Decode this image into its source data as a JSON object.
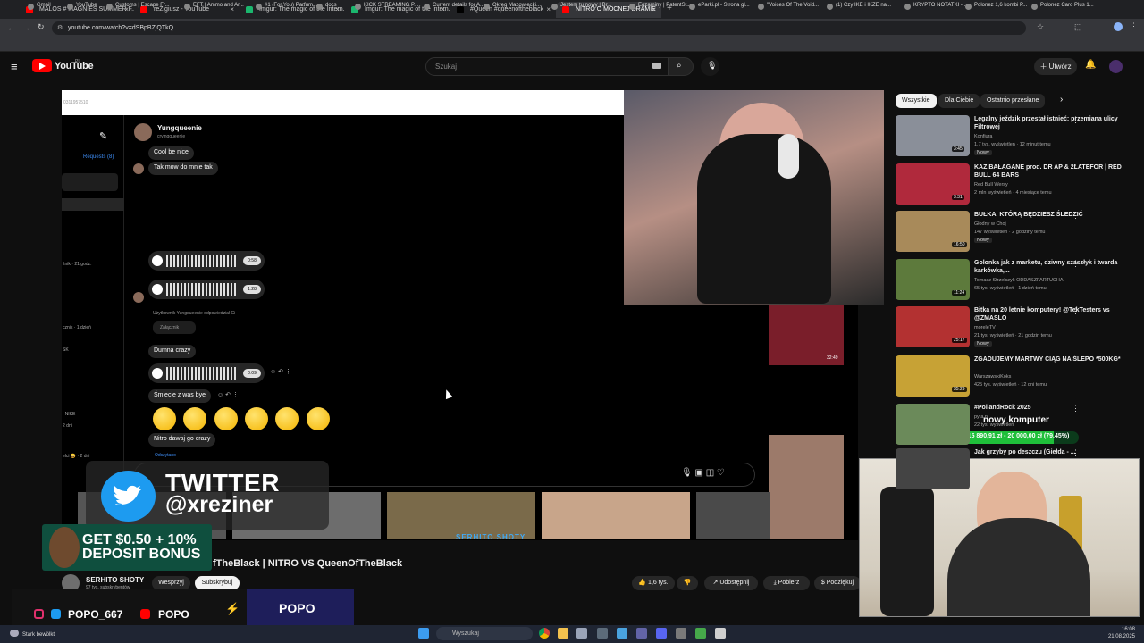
{
  "tabs": [
    {
      "label": "MALOS # MAGNIES SUMMER F...",
      "color": "#ff0000"
    },
    {
      "label": "reZigiusz - YouTube",
      "color": "#ff0000"
    },
    {
      "label": "Imgur: The magic of the Intern...",
      "color": "#1bb76e"
    },
    {
      "label": "Imgur: The magic of the Intern...",
      "color": "#1bb76e"
    },
    {
      "label": "#Queen #queenoftheblack",
      "color": "#000000"
    },
    {
      "label": "NITRO O MOCNEJ DRAMIE",
      "color": "#ff0000"
    }
  ],
  "address": {
    "url": "youtube.com/watch?v=dSBpBZjQTkQ"
  },
  "bookmarks": [
    "Gmail",
    "YouTube",
    "Customs | Escape Fr...",
    "EFT | Ammo and Ar...",
    "#1 (For You) Parfum...",
    "docs",
    "KICK STREAMING P...",
    "Current details for A...",
    "Okręg Mazowiecki...",
    "Jestem tu nowy | Br...",
    "Egzaminy | PatentSt...",
    "eParki.pl - Strona gl...",
    "\"Voices Of The Void...",
    "(1) Czy IKE i IKZE na...",
    "KRYPTO NOTATKI -...",
    "Polonez 1,6 kombi P...",
    "Polonez Caro Plus 1..."
  ],
  "header": {
    "logo": "YouTube",
    "logo_sup": "PL",
    "search_placeholder": "Szukaj",
    "create_label": "Utwórz"
  },
  "ig": {
    "chat_id": "0311957510",
    "username": "Yungqueenie",
    "handle": "cryingqueenie",
    "requests": "Requests (8)",
    "side_items": [
      "źnik · 21 godz.",
      "cznik · 1 dzień",
      "SK",
      "| NIKE",
      "2 dni",
      "elci 😀 · 2 dni"
    ],
    "messages": [
      "Cool be nice",
      "Tak mow do mnie tak",
      "Dumna crazy",
      "Śmiecie z was bye",
      "Nitro dawaj go crazy"
    ],
    "reply_note": "Użytkownik Yungqueenie odpowiedział Ci",
    "attachment": "Załącznik",
    "voice_durations": [
      "0:58",
      "1:28",
      "0:09"
    ],
    "seen": "Odczytano"
  },
  "overlays": {
    "twitter_title": "TWITTER",
    "twitter_handle": "@xreziner_",
    "bonus_line1": "GET $0.50 + 10%",
    "bonus_line2": "DEPOSIT BONUS",
    "shorts_tag": "SERHITO SHOTY",
    "popo_handle": "POPO_667",
    "popo_name": "POPO",
    "popo_title": "POPO",
    "goal_title": "nowy komputer",
    "goal_text": "15 890,91 zł - 20 000,00 zł (79.45%)",
    "goal_fraction": 0.7945
  },
  "video": {
    "title": "fTheBlack | NITRO VS QueenOfTheBlack",
    "channel": "SERHITO SHOTY",
    "subs": "97 tys. subskrybentów",
    "join_label": "Wesprzyj",
    "subscribe_label": "Subskrybuj",
    "likes": "1,6 tys.",
    "share_label": "Udostępnij",
    "download_label": "Pobierz",
    "thanks_label": "Podziękuj",
    "player_duration": "32:49"
  },
  "chips": [
    "Wszystkie",
    "Dla Ciebie",
    "Ostatnio przesłane"
  ],
  "recommendations": [
    {
      "title": "Legalny jeździk przestał istnieć: przemiana ulicy Filtrowej",
      "channel": "Konfiura",
      "meta": "1,7 tys. wyświetleń · 12 minut temu",
      "badge": "Nowy",
      "duration": "3:45",
      "color": "#8a8f99"
    },
    {
      "title": "KAZ BAŁAGANE prod. DR AP & 2LATEFOR | RED BULL 64 BARS",
      "channel": "Red Bull Wersy",
      "meta": "2 mln wyświetleń · 4 miesiące temu",
      "badge": "",
      "duration": "3:31",
      "color": "#b0293c"
    },
    {
      "title": "BUŁKA, KTÓRĄ BĘDZIESZ ŚLEDZIĆ",
      "channel": "Głodny w Choj",
      "meta": "147 wyświetleń · 2 godziny temu",
      "badge": "Nowy",
      "duration": "16:50",
      "color": "#a88a5a"
    },
    {
      "title": "Golonka jak z marketu, dziwny szaszłyk i twarda karkówka,...",
      "channel": "Tomasz Strzelczyk ODDASZFARTUCHA",
      "meta": "65 tys. wyświetleń · 1 dzień temu",
      "badge": "",
      "duration": "11:24",
      "color": "#5d7a3c"
    },
    {
      "title": "Bitka na 20 letnie komputery! @TekTesters vs @ZMASLO",
      "channel": "moreleTV",
      "meta": "21 tys. wyświetleń · 21 godzin temu",
      "badge": "Nowy",
      "duration": "25:17",
      "color": "#b33131"
    },
    {
      "title": "ZGADUJEMY MARTWY CIĄG NA ŚLEPO *500KG*",
      "channel": "WarszawskiKoks",
      "meta": "425 tys. wyświetleń · 12 dni temu",
      "badge": "",
      "duration": "35:29",
      "color": "#c7a235"
    },
    {
      "title": "#Pol'andRock 2025",
      "channel": "pyta.pl",
      "meta": "22 tys. wyświetleń",
      "badge": "",
      "duration": "",
      "color": "#6b8a5a"
    },
    {
      "title": "Jak grzyby po deszczu (Giełda - ...",
      "channel": "",
      "meta": "",
      "badge": "",
      "duration": "",
      "color": "#444444"
    }
  ],
  "taskbar": {
    "search_placeholder": "Wyszukaj",
    "time": "16:08",
    "date": "21.08.2025",
    "status_left": "Stark bewölkt"
  }
}
